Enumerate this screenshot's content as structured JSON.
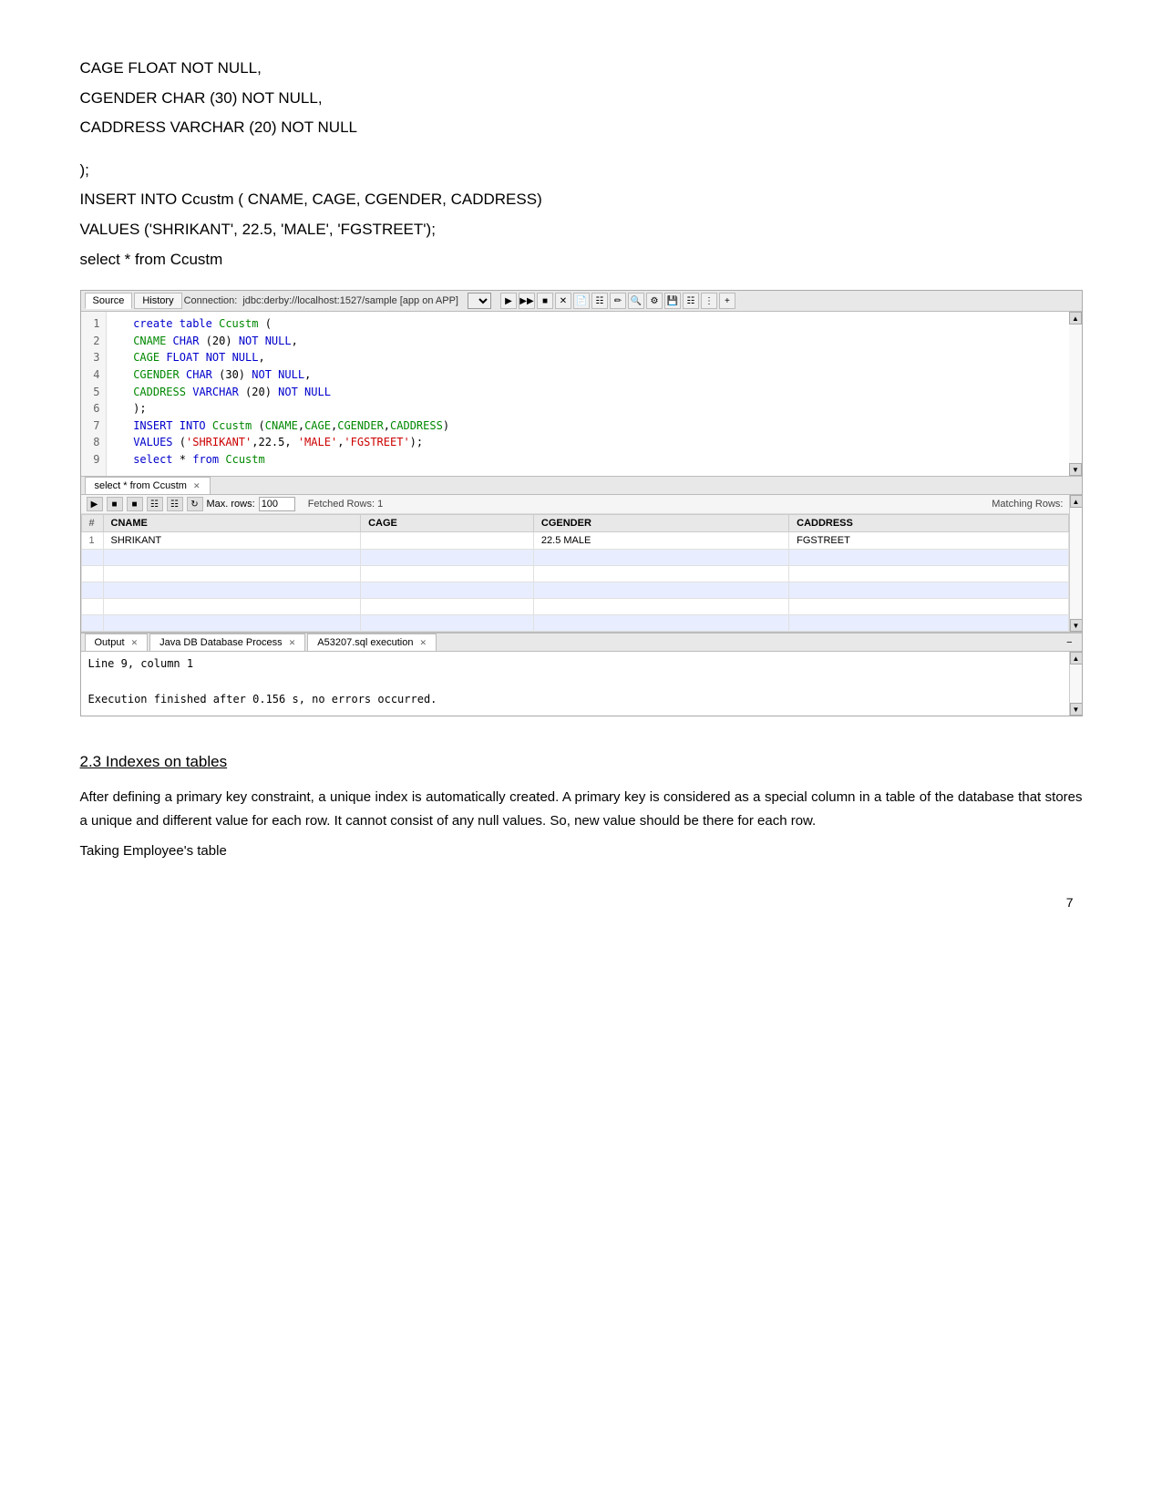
{
  "header_sql_lines": [
    "CAGE FLOAT NOT NULL,",
    "CGENDER CHAR (30) NOT NULL,",
    "CADDRESS VARCHAR (20) NOT NULL"
  ],
  "header_extra_lines": [
    ");",
    "INSERT INTO Ccustm ( CNAME, CAGE, CGENDER, CADDRESS)",
    "VALUES ('SHRIKANT', 22.5, 'MALE', 'FGSTREET');",
    "select * from Ccustm"
  ],
  "ide": {
    "tabs": [
      "Source",
      "History"
    ],
    "connection_label": "Connection:",
    "connection_value": "jdbc:derby://localhost:1527/sample [app on APP]",
    "active_tab": "Source",
    "code_lines": [
      "   create table Ccustm (",
      "   CNAME CHAR (20) NOT NULL,",
      "   CAGE FLOAT NOT NULL,",
      "   CGENDER CHAR (30) NOT NULL,",
      "   CADDRESS VARCHAR (20) NOT NULL",
      "   );",
      "   INSERT INTO Ccustm (CNAME,CAGE,CGENDER,CADDRESS)",
      "   VALUES ('SHRIKANT',22.5, 'MALE','FGSTREET');",
      "   select * from Ccustm"
    ],
    "line_numbers": [
      "1",
      "2",
      "3",
      "4",
      "5",
      "6",
      "7",
      "8",
      "9"
    ],
    "results_tab": "select * from Ccustm",
    "toolbar": {
      "max_rows_label": "Max. rows:",
      "max_rows_value": "100",
      "fetched_rows": "Fetched Rows: 1",
      "matching_rows": "Matching Rows:"
    },
    "table": {
      "columns": [
        "#",
        "CNAME",
        "CAGE",
        "CGENDER",
        "CADDRESS"
      ],
      "rows": [
        [
          "1",
          "SHRIKANT",
          "",
          "22.5 MALE",
          "FGSTREET"
        ]
      ]
    },
    "output_tabs": [
      "Output",
      "Java DB Database Process",
      "A53207.sql execution"
    ],
    "output_content": [
      "Line 9, column 1",
      "",
      "Execution finished after 0.156 s, no errors occurred."
    ]
  },
  "section": {
    "heading": "2.3 Indexes on tables",
    "paragraph": "After defining a primary key constraint, a unique index is automatically created. A primary key is considered as a special column in a table of the database that stores a unique and different value for each row. It cannot consist of any null values. So, new value should be there for each row.",
    "taking_employee": "Taking Employee's table"
  },
  "page_number": "7"
}
